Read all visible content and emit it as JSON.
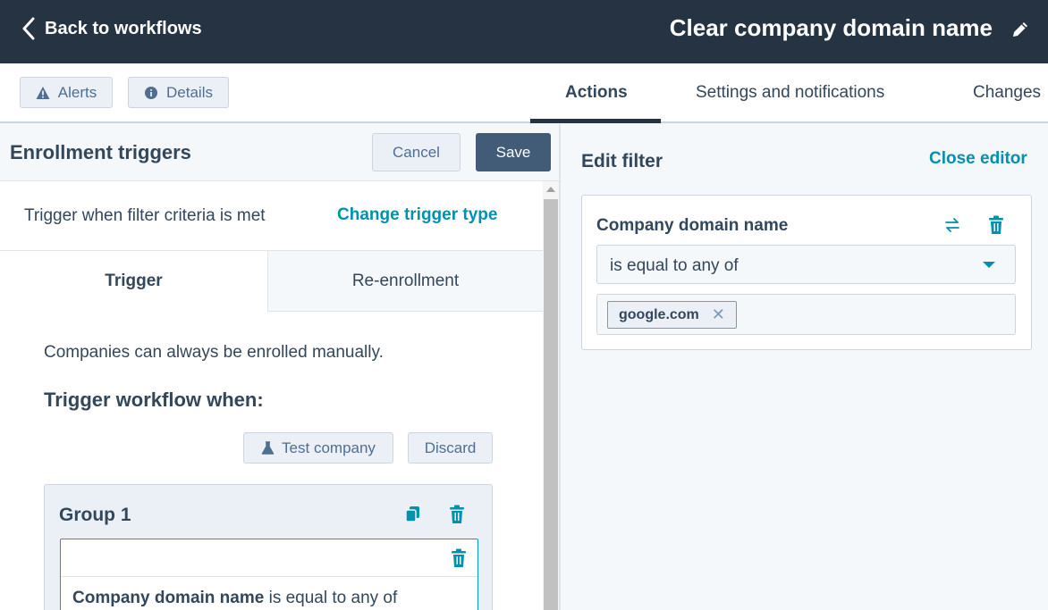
{
  "topbar": {
    "back_label": "Back to workflows",
    "workflow_title": "Clear company domain name",
    "edit_icon": "pencil-icon"
  },
  "navbar": {
    "alerts_label": "Alerts",
    "details_label": "Details",
    "tabs": [
      {
        "label": "Actions",
        "active": true
      },
      {
        "label": "Settings and notifications",
        "active": false
      },
      {
        "label": "Changes",
        "active": false
      }
    ]
  },
  "left_panel": {
    "title": "Enrollment triggers",
    "cancel_label": "Cancel",
    "save_label": "Save",
    "trigger_text": "Trigger when filter criteria is met",
    "change_trigger_label": "Change trigger type",
    "subtabs": [
      {
        "label": "Trigger",
        "active": true
      },
      {
        "label": "Re-enrollment",
        "active": false
      }
    ],
    "manual_note": "Companies can always be enrolled manually.",
    "trigger_heading": "Trigger workflow when:",
    "test_company_label": "Test company",
    "discard_label": "Discard",
    "group": {
      "title": "Group 1",
      "filter_property": "Company domain name",
      "filter_operator": "is equal to any of"
    }
  },
  "right_panel": {
    "title": "Edit filter",
    "close_label": "Close editor",
    "property_label": "Company domain name",
    "operator_value": "is equal to any of",
    "values": [
      "google.com"
    ]
  },
  "colors": {
    "topbar_bg": "#253342",
    "accent": "#0091ae",
    "save_bg": "#425b76",
    "focus_border": "#00a4bd"
  }
}
